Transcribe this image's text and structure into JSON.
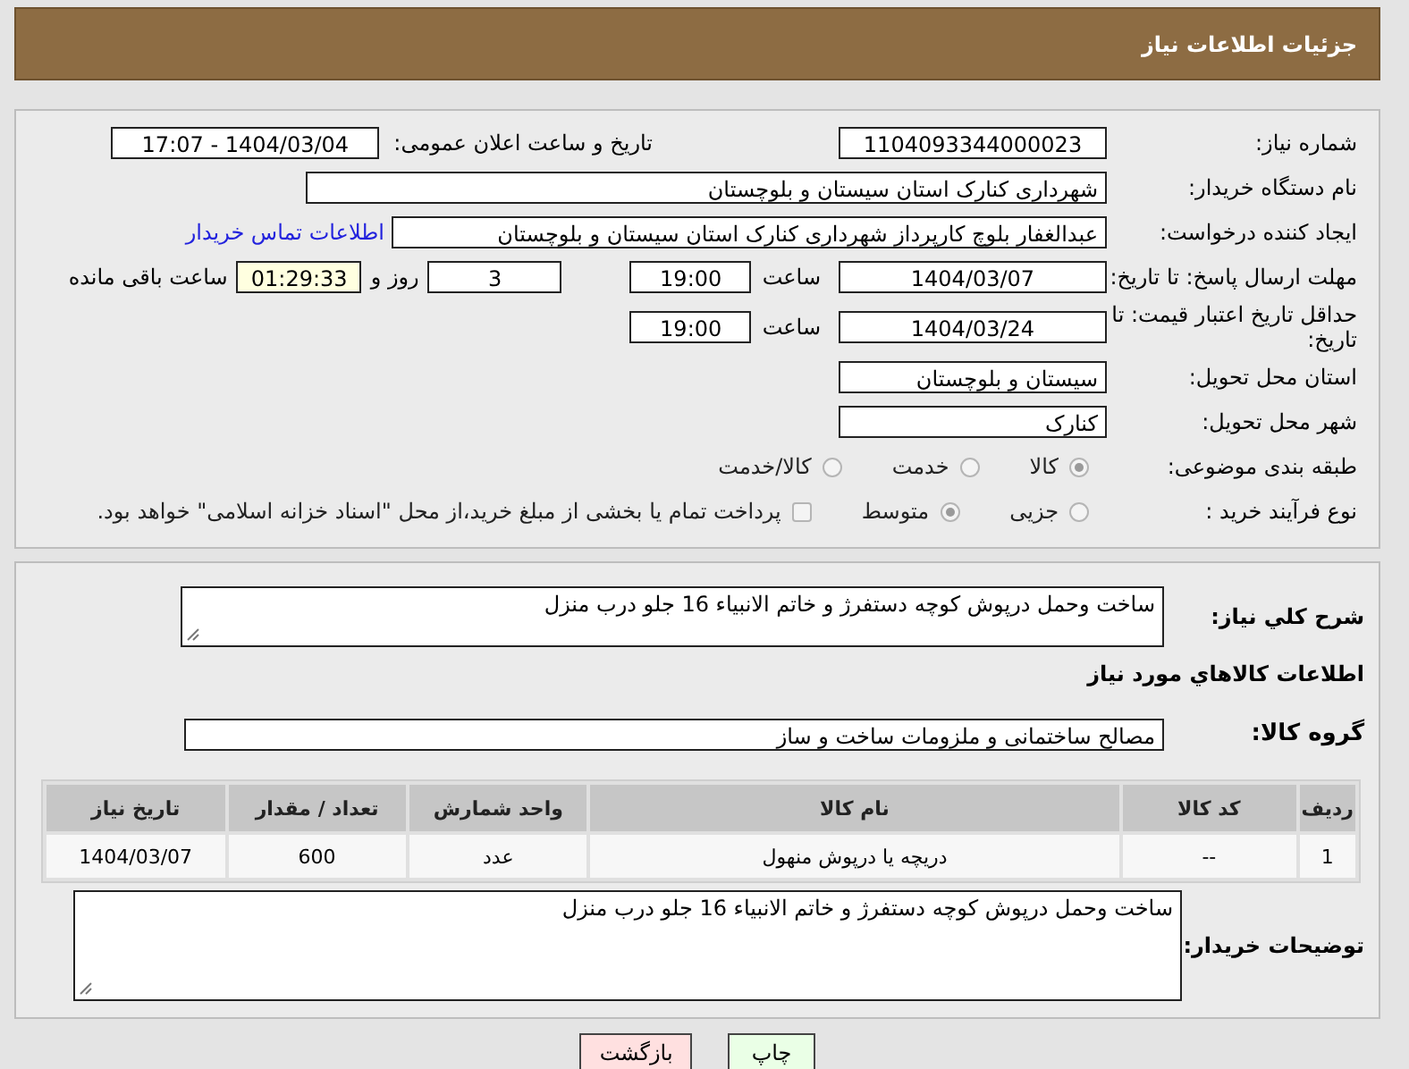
{
  "header": {
    "title": "جزئیات اطلاعات نیاز"
  },
  "need_number": {
    "label": "شماره نیاز:",
    "value": "1104093344000023"
  },
  "announce": {
    "label": "تاریخ و ساعت اعلان عمومی:",
    "value": "1404/03/04 - 17:07"
  },
  "buyer_org": {
    "label": "نام دستگاه خریدار:",
    "value": "شهرداری کنارک استان سیستان و بلوچستان"
  },
  "requester": {
    "label": "ایجاد کننده درخواست:",
    "value": "عبدالغفار بلوچ کارپرداز شهرداری کنارک استان سیستان و بلوچستان",
    "link": "اطلاعات تماس خریدار"
  },
  "deadline": {
    "label": "مهلت ارسال پاسخ: تا تاریخ:",
    "date": "1404/03/07",
    "time_label": "ساعت",
    "time": "19:00",
    "days": "3",
    "days_label": "روز و",
    "remaining": "01:29:33",
    "remaining_label": "ساعت باقی مانده"
  },
  "price_validity": {
    "label": "حداقل تاریخ اعتبار قیمت: تا تاریخ:",
    "date": "1404/03/24",
    "time_label": "ساعت",
    "time": "19:00"
  },
  "province": {
    "label": "استان محل تحویل:",
    "value": "سیستان و بلوچستان"
  },
  "city": {
    "label": "شهر محل تحویل:",
    "value": "کنارک"
  },
  "category": {
    "label": "طبقه بندی موضوعی:",
    "options": [
      {
        "label": "کالا",
        "selected": true
      },
      {
        "label": "خدمت",
        "selected": false
      },
      {
        "label": "کالا/خدمت",
        "selected": false
      }
    ]
  },
  "process": {
    "label": "نوع فرآیند خرید :",
    "options": [
      {
        "label": "جزیی",
        "selected": false
      },
      {
        "label": "متوسط",
        "selected": true
      }
    ],
    "payment": {
      "label": "پرداخت تمام یا بخشی از مبلغ خرید،از محل \"اسناد خزانه اسلامی\" خواهد بود.",
      "checked": false
    }
  },
  "description": {
    "label": "شرح كلي نياز:",
    "value": "ساخت وحمل درپوش کوچه دستفرژ و خاتم الانبیاء 16 جلو درب منزل"
  },
  "goods_heading": "اطلاعات كالاهاي مورد نياز",
  "goods_group": {
    "label": "گروه کالا:",
    "value": "مصالح ساختمانی و ملزومات ساخت و ساز"
  },
  "table": {
    "columns": [
      "ردیف",
      "کد کالا",
      "نام کالا",
      "واحد شمارش",
      "تعداد / مقدار",
      "تاریخ نیاز"
    ],
    "rows": [
      [
        "1",
        "--",
        "دریچه یا درپوش منهول",
        "عدد",
        "600",
        "1404/03/07"
      ]
    ]
  },
  "buyer_notes": {
    "label": "توضیحات خریدار:",
    "value": "ساخت وحمل درپوش کوچه دستفرژ و خاتم الانبیاء 16 جلو درب منزل"
  },
  "buttons": [
    {
      "label": "چاپ",
      "kind": "print"
    },
    {
      "label": "بازگشت",
      "kind": "back"
    }
  ]
}
